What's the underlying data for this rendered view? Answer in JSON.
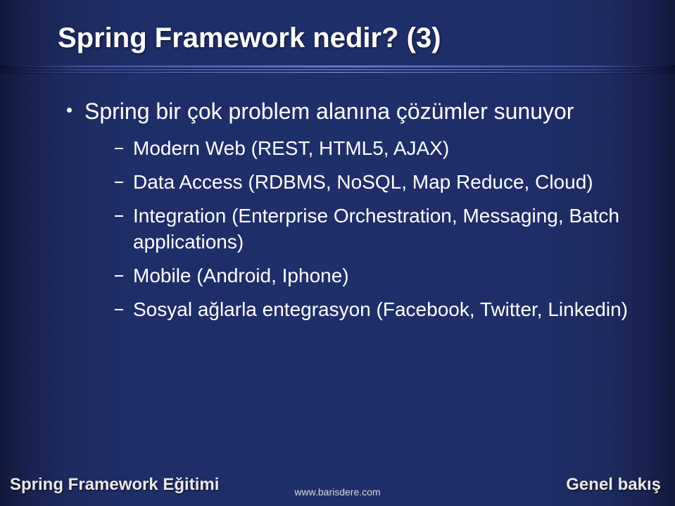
{
  "title": "Spring Framework nedir? (3)",
  "bullet": "Spring bir çok problem alanına çözümler sunuyor",
  "subitems": [
    "Modern Web (REST, HTML5, AJAX)",
    "Data Access (RDBMS, NoSQL, Map Reduce, Cloud)",
    "Integration (Enterprise Orchestration, Messaging, Batch applications)",
    "Mobile (Android, Iphone)",
    "Sosyal ağlarla entegrasyon (Facebook, Twitter, Linkedin)"
  ],
  "footer": {
    "left": "Spring Framework Eğitimi",
    "center": "www.barisdere.com",
    "right": "Genel bakış"
  }
}
